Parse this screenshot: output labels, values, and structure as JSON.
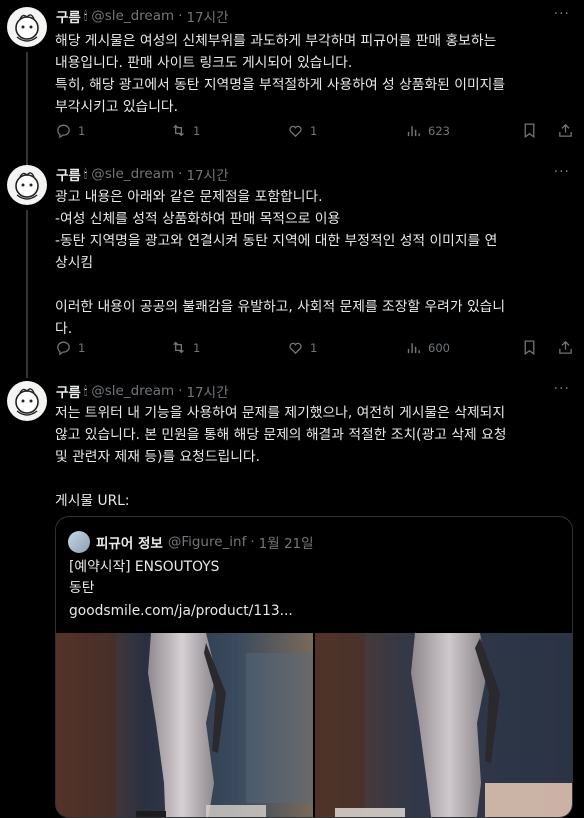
{
  "tweets": [
    {
      "name": "구름",
      "handle": "@sle_dream",
      "dot": "·",
      "time": "17시간",
      "more": "···",
      "lines": [
        "해당 게시물은 여성의 신체부위를 과도하게 부각하며 피규어를 판매 홍보하는",
        "내용입니다. 판매 사이트 링크도 게시되어 있습니다.",
        "특히, 해당 광고에서 동탄 지역명을 부적절하게 사용하여 성 상품화된 이미지를",
        "부각시키고 있습니다."
      ],
      "replies": "1",
      "retweets": "1",
      "likes": "1",
      "views": "623"
    },
    {
      "name": "구름",
      "handle": "@sle_dream",
      "dot": "·",
      "time": "17시간",
      "more": "···",
      "lines": [
        "광고 내용은 아래와 같은 문제점을 포함합니다.",
        "-여성 신체를 성적 상품화하여 판매 목적으로 이용",
        "-동탄 지역명을 광고와 연결시켜 동탄 지역에 대한 부정적인 성적 이미지를 연",
        "상시킴",
        "",
        "이러한 내용이 공공의 불쾌감을 유발하고, 사회적 문제를 조장할 우려가 있습니",
        "다."
      ],
      "replies": "1",
      "retweets": "1",
      "likes": "1",
      "views": "600"
    },
    {
      "name": "구름",
      "handle": "@sle_dream",
      "dot": "·",
      "time": "17시간",
      "more": "···",
      "lines": [
        "저는 트위터 내 기능을 사용하여 문제를 제기했으나, 여전히 게시물은 삭제되지",
        "않고 있습니다. 본 민원을 통해 해당 문제의 해결과 적절한 조치(광고 삭제 요청",
        "및 관련자 제재 등)를 요청드립니다.",
        "",
        "게시물 URL:"
      ]
    }
  ],
  "quote": {
    "name": "피규어 정보",
    "handle": "@Figure_inf",
    "dot": "·",
    "date": "1월 21일",
    "line1": "[예약시작] ENSOUTOYS",
    "line2": "동탄",
    "link": "goodsmile.com/ja/product/113..."
  },
  "icons": {
    "reply": "reply-icon",
    "retweet": "retweet-icon",
    "like": "heart-icon",
    "views": "views-icon",
    "bookmark": "bookmark-icon",
    "share": "share-icon"
  },
  "colors": {
    "background": "#000000",
    "text": "#e7e9ea",
    "muted": "#71767b",
    "border": "#2f3336"
  }
}
